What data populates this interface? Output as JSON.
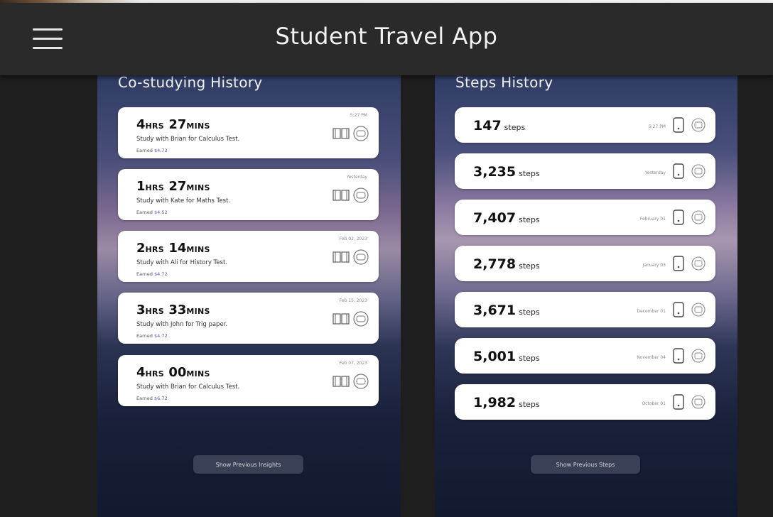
{
  "app": {
    "title": "Student Travel App"
  },
  "co_studying": {
    "title": "Co-studying History",
    "cards": [
      {
        "hrs": "4",
        "hrs_unit": "HRS",
        "mins": "27",
        "mins_unit": "MINS",
        "desc": "Study with Brian for Calculus Test.",
        "earned_label": "Earned",
        "earned_value": "$4.72",
        "date": "5:27 PM"
      },
      {
        "hrs": "1",
        "hrs_unit": "HRS",
        "mins": "27",
        "mins_unit": "MINS",
        "desc": "Study with Kate for Maths Test.",
        "earned_label": "Earned",
        "earned_value": "$4.52",
        "date": "Yesterday"
      },
      {
        "hrs": "2",
        "hrs_unit": "HRS",
        "mins": "14",
        "mins_unit": "MINS",
        "desc": "Study with Ali for History Test.",
        "earned_label": "Earned",
        "earned_value": "$4.72",
        "date": "Feb 02, 2023"
      },
      {
        "hrs": "3",
        "hrs_unit": "HRS",
        "mins": "33",
        "mins_unit": "MINS",
        "desc": "Study with John for Trig paper.",
        "earned_label": "Earned",
        "earned_value": "$4.72",
        "date": "Feb 15, 2023"
      },
      {
        "hrs": "4",
        "hrs_unit": "HRS",
        "mins": "00",
        "mins_unit": "MINS",
        "desc": "Study with Brian for Calculus Test.",
        "earned_label": "Earned",
        "earned_value": "$6.72",
        "date": "Feb 07, 2023"
      }
    ],
    "show_button": "Show Previous Insights"
  },
  "steps": {
    "title": "Steps History",
    "unit": "steps",
    "cards": [
      {
        "count": "147",
        "date": "5:27 PM"
      },
      {
        "count": "3,235",
        "date": "Yesterday"
      },
      {
        "count": "7,407",
        "date": "February 01"
      },
      {
        "count": "2,778",
        "date": "January 03"
      },
      {
        "count": "3,671",
        "date": "December 01"
      },
      {
        "count": "5,001",
        "date": "November 04"
      },
      {
        "count": "1,982",
        "date": "October 01"
      }
    ],
    "show_button": "Show Previous Steps"
  },
  "icons": {
    "menu": "hamburger-icon",
    "book": "book-icon",
    "coin": "coin-icon",
    "phone": "phone-icon"
  }
}
